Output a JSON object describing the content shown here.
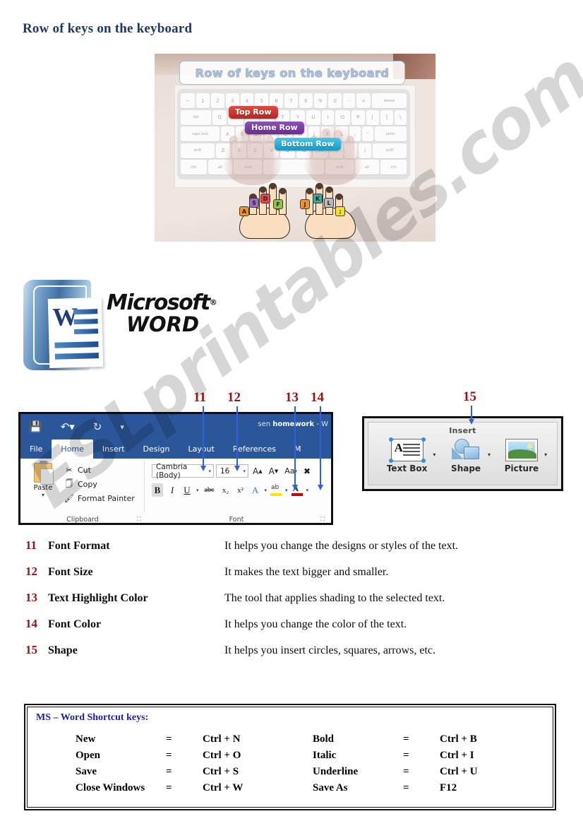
{
  "page": {
    "title": "Row of keys on the keyboard",
    "watermark": "ESLprintables.com"
  },
  "hero": {
    "banner_title": "Row of keys on the keyboard",
    "row_labels": [
      {
        "text": "Top Row",
        "color": "#b62720"
      },
      {
        "text": "Home Row",
        "color": "#6a2d93"
      },
      {
        "text": "Bottom Row",
        "color": "#1697c6"
      }
    ],
    "keyboard": {
      "row1": [
        "~",
        "1",
        "2",
        "3",
        "4",
        "5",
        "6",
        "7",
        "8",
        "9",
        "0",
        "-",
        "=",
        "delete"
      ],
      "row2": [
        "tab",
        "Q",
        "W",
        "E",
        "R",
        "T",
        "Y",
        "U",
        "I",
        "O",
        "P",
        "[",
        "]",
        "\\"
      ],
      "row3": [
        "caps lock",
        "A",
        "S",
        "D",
        "F",
        "G",
        "H",
        "J",
        "K",
        "L",
        ";",
        "'",
        "enter"
      ],
      "row4": [
        "shift",
        "Z",
        "X",
        "C",
        "V",
        "B",
        "N",
        "M",
        ",",
        ".",
        "/",
        "shift"
      ],
      "row5": [
        "ctrl",
        "alt",
        "cmd",
        "",
        "cmd",
        "alt",
        "ctrl"
      ]
    },
    "home_row_keys": [
      {
        "label": "A",
        "color": "#f0922b"
      },
      {
        "label": "S",
        "color": "#9b6dc4"
      },
      {
        "label": "D",
        "color": "#e04a43"
      },
      {
        "label": "F",
        "color": "#8cc63f"
      },
      {
        "label": "J",
        "color": "#f0922b"
      },
      {
        "label": "K",
        "color": "#3ba99c"
      },
      {
        "label": "L",
        "color": "#b9b9b9"
      },
      {
        "label": ";",
        "color": "#f2e32b"
      }
    ]
  },
  "word_logo": {
    "brand": "Microsoft",
    "product": "WORD",
    "doc_letter": "W",
    "registered": "®"
  },
  "callouts": [
    {
      "number": "11"
    },
    {
      "number": "12"
    },
    {
      "number": "13"
    },
    {
      "number": "14"
    },
    {
      "number": "15"
    }
  ],
  "ribbon": {
    "quick_access": [
      "save-icon",
      "undo-icon",
      "redo-icon",
      "customize-icon"
    ],
    "document_title_prefix": "sen ",
    "document_title_bold": "homework",
    "document_title_suffix": " - W",
    "tabs": [
      {
        "label": "File",
        "active": false
      },
      {
        "label": "Home",
        "active": true
      },
      {
        "label": "Insert",
        "active": false
      },
      {
        "label": "Design",
        "active": false
      },
      {
        "label": "Layout",
        "active": false
      },
      {
        "label": "References",
        "active": false
      },
      {
        "label": "M",
        "active": false
      }
    ],
    "clipboard": {
      "group_name": "Clipboard",
      "paste_label": "Paste",
      "items": [
        {
          "label": "Cut",
          "icon": "scissors-icon"
        },
        {
          "label": "Copy",
          "icon": "copy-icon"
        },
        {
          "label": "Format Painter",
          "icon": "paintbrush-icon"
        }
      ]
    },
    "font_group": {
      "group_name": "Font",
      "font_name": "Cambria (Body)",
      "font_size": "16",
      "grow_font": "A",
      "shrink_font": "A",
      "change_case": "Aa",
      "clear_formatting": "A",
      "bold": "B",
      "italic": "I",
      "underline": "U",
      "strikethrough": "abc",
      "subscript": "x₂",
      "superscript": "x²",
      "text_effects": "A",
      "highlight": "ab",
      "font_color": "A"
    }
  },
  "insert_panel": {
    "header": "Insert",
    "tools": [
      {
        "label": "Text Box",
        "icon": "textbox-icon"
      },
      {
        "label": "Shape",
        "icon": "shape-icon"
      },
      {
        "label": "Picture",
        "icon": "picture-icon"
      }
    ]
  },
  "definitions": [
    {
      "num": "11",
      "term": "Font Format",
      "desc": "It helps you change the designs or styles of the text."
    },
    {
      "num": "12",
      "term": "Font Size",
      "desc": "It makes the text bigger and smaller."
    },
    {
      "num": "13",
      "term": "Text Highlight Color",
      "desc": "The tool that applies shading to the selected text."
    },
    {
      "num": "14",
      "term": "Font Color",
      "desc": "It helps you change the color of the text."
    },
    {
      "num": "15",
      "term": "Shape",
      "desc": "It helps you insert circles, squares, arrows, etc."
    }
  ],
  "shortcuts": {
    "title": "MS – Word Shortcut keys:",
    "equals": "=",
    "left": [
      {
        "name": "New",
        "key": "Ctrl + N"
      },
      {
        "name": "Open",
        "key": "Ctrl + O"
      },
      {
        "name": "Save",
        "key": "Ctrl + S"
      },
      {
        "name": "Close Windows",
        "key": "Ctrl + W"
      }
    ],
    "right": [
      {
        "name": "Bold",
        "key": "Ctrl + B"
      },
      {
        "name": "Italic",
        "key": "Ctrl + I"
      },
      {
        "name": "Underline",
        "key": "Ctrl + U"
      },
      {
        "name": "Save As",
        "key": "F12"
      }
    ]
  }
}
